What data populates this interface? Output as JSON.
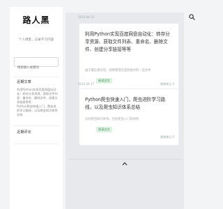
{
  "sidebar": {
    "site_title": "路人黑",
    "tagline": "个人博客，记录学习内容",
    "search_placeholder": "搜索输入关键词",
    "recent_posts_title": "近期文章",
    "recent_posts": [
      "利用Python实现百度网盘自动化：转存分享资源、获取文件列表、重命名、删除文件、创建分享链接等等",
      "Python爬虫快速入门，爬虫进阶学习路线，以及爬虫知识体系总结"
    ],
    "recent_comments_title": "近期评论"
  },
  "posts": [
    {
      "date": "2022-04-22",
      "title": "利用Python实现百度网盘自动化：转存分享资源、获取文件列表、重命名、删除文件、创建分享链接等等",
      "excerpt": "由于最近想实现，想要整理百度网盘中的一些文件",
      "read_more": "阅读全文",
      "meta": "随笔笔记  0"
    },
    {
      "date": "2022-04-17",
      "title": "Python爬虫快速入门，爬虫进阶学习路线，以及爬虫知识体系总结",
      "excerpt": "总结爬虫知识体系，包括爬虫入门和进阶",
      "read_more": "阅读全文",
      "meta": "随笔笔记  0"
    }
  ],
  "icons": {
    "search": "search-icon",
    "back_to_top": "chevron-up-icon"
  },
  "colors": {
    "accent_green": "#4a8a5a",
    "tag_bg": "#dff3e4"
  }
}
